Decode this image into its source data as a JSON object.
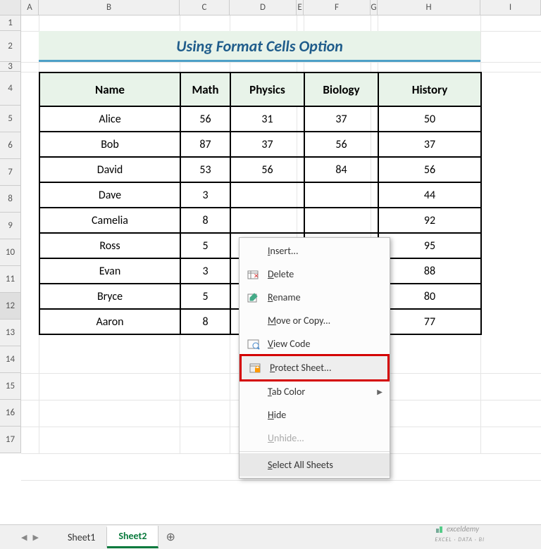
{
  "columns": [
    "A",
    "B",
    "C",
    "D",
    "E",
    "F",
    "G",
    "H",
    "I"
  ],
  "rows": [
    "1",
    "2",
    "3",
    "4",
    "5",
    "6",
    "7",
    "8",
    "9",
    "10",
    "11",
    "12",
    "13",
    "14",
    "15",
    "16",
    "17"
  ],
  "title": "Using Format Cells Option",
  "headers": {
    "name": "Name",
    "math": "Math",
    "physics": "Physics",
    "biology": "Biology",
    "history": "History"
  },
  "chart_data": {
    "type": "table",
    "columns": [
      "Name",
      "Math",
      "Physics",
      "Biology",
      "History"
    ],
    "rows": [
      [
        "Alice",
        56,
        31,
        37,
        50
      ],
      [
        "Bob",
        87,
        37,
        56,
        37
      ],
      [
        "David",
        53,
        56,
        84,
        56
      ],
      [
        "Dave",
        3,
        null,
        null,
        44
      ],
      [
        "Camelia",
        8,
        null,
        null,
        92
      ],
      [
        "Ross",
        5,
        null,
        null,
        95
      ],
      [
        "Evan",
        3,
        null,
        null,
        88
      ],
      [
        "Bryce",
        5,
        null,
        null,
        80
      ],
      [
        "Aaron",
        8,
        null,
        null,
        77
      ]
    ]
  },
  "menu": {
    "insert": "Insert...",
    "delete": "Delete",
    "rename": "Rename",
    "move": "Move or Copy...",
    "viewcode": "View Code",
    "protect": "Protect Sheet...",
    "tabcolor": "Tab Color",
    "hide": "Hide",
    "unhide": "Unhide...",
    "selectall": "Select All Sheets"
  },
  "tabs": {
    "sheet1": "Sheet1",
    "sheet2": "Sheet2"
  },
  "watermark": {
    "main": "exceldemy",
    "sub": "EXCEL · DATA · BI"
  }
}
